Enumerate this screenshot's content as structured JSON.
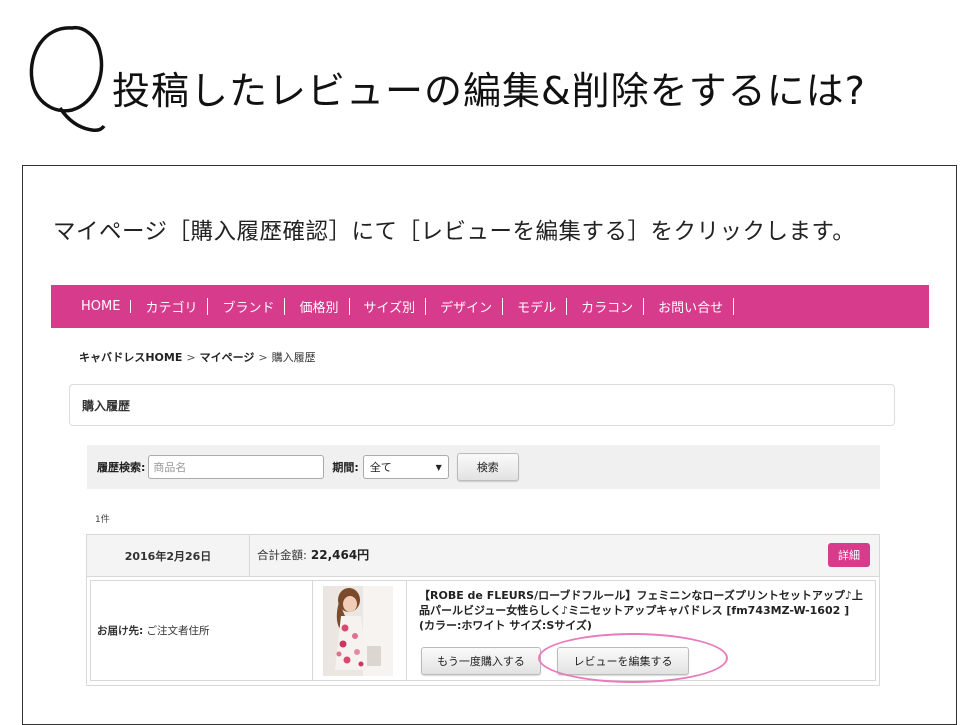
{
  "slide": {
    "title": "投稿したレビューの編集&削除をするには?",
    "instruction": "マイページ［購入履歴確認］にて［レビューを編集する］をクリックします。"
  },
  "nav": {
    "items": [
      "HOME",
      "カテゴリ",
      "ブランド",
      "価格別",
      "サイズ別",
      "デザイン",
      "モデル",
      "カラコン",
      "お問い合せ"
    ]
  },
  "breadcrumb": {
    "home": "キャバドレスHOME",
    "separator": ">",
    "mypage": "マイページ",
    "current": "購入履歴"
  },
  "history": {
    "heading": "購入履歴"
  },
  "search": {
    "label": "履歴検索:",
    "placeholder": "商品名",
    "period_label": "期間:",
    "period_value": "全て",
    "button": "検索"
  },
  "results": {
    "count": "1件"
  },
  "order": {
    "date": "2016年2月26日",
    "total_label": "合計金額:",
    "total_amount": "22,464円",
    "detail_button": "詳細",
    "delivery_label": "お届け先:",
    "delivery_value": "ご注文者住所",
    "product_name": "【ROBE de FLEURS/ローブドフルール】フェミニンなローズプリントセットアップ♪上品パールビジュー女性らしく♪ミニセットアップキャバドレス [fm743MZ-W-1602 ]",
    "product_option": "(カラー:ホワイト サイズ:Sサイズ)",
    "rebuy_button": "もう一度購入する",
    "review_button": "レビューを編集する"
  },
  "colors": {
    "accent": "#d63b8c",
    "highlight": "#e87bbd"
  }
}
